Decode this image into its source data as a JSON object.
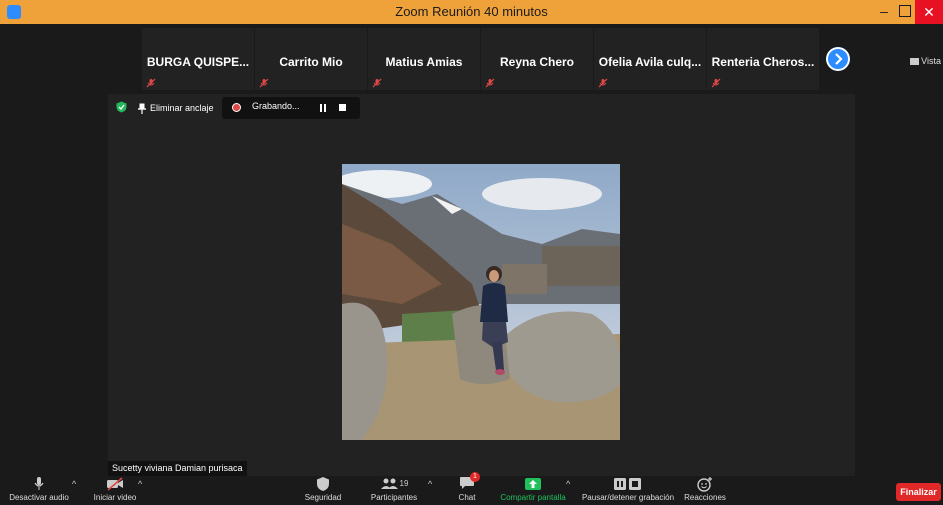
{
  "window": {
    "title": "Zoom Reunión 40 minutos"
  },
  "participants_strip": [
    {
      "name": "BURGA QUISPE..."
    },
    {
      "name": "Carrito Mio"
    },
    {
      "name": "Matius Amias"
    },
    {
      "name": "Reyna Chero"
    },
    {
      "name": "Ofelia Avila culq..."
    },
    {
      "name": "Renteria Cheros..."
    }
  ],
  "view_button": {
    "label": "Vista"
  },
  "stage": {
    "unpin_label": "Eliminar anclaje",
    "recording_label": "Grabando...",
    "speaker_name": "Sucetty viviana Damian purisaca"
  },
  "toolbar": {
    "mute_label": "Desactivar audio",
    "video_label": "Iniciar video",
    "security_label": "Seguridad",
    "participants_label": "Participantes",
    "participants_count": "19",
    "chat_label": "Chat",
    "chat_badge": "1",
    "share_label": "Compartir pantalla",
    "record_label": "Pausar/detener grabación",
    "reactions_label": "Reacciones",
    "end_label": "Finalizar"
  },
  "colors": {
    "titlebar": "#f0a23a",
    "accent": "#2d8cff",
    "share_green": "#20c05c",
    "end_red": "#e02828",
    "muted_red": "#e14848"
  }
}
